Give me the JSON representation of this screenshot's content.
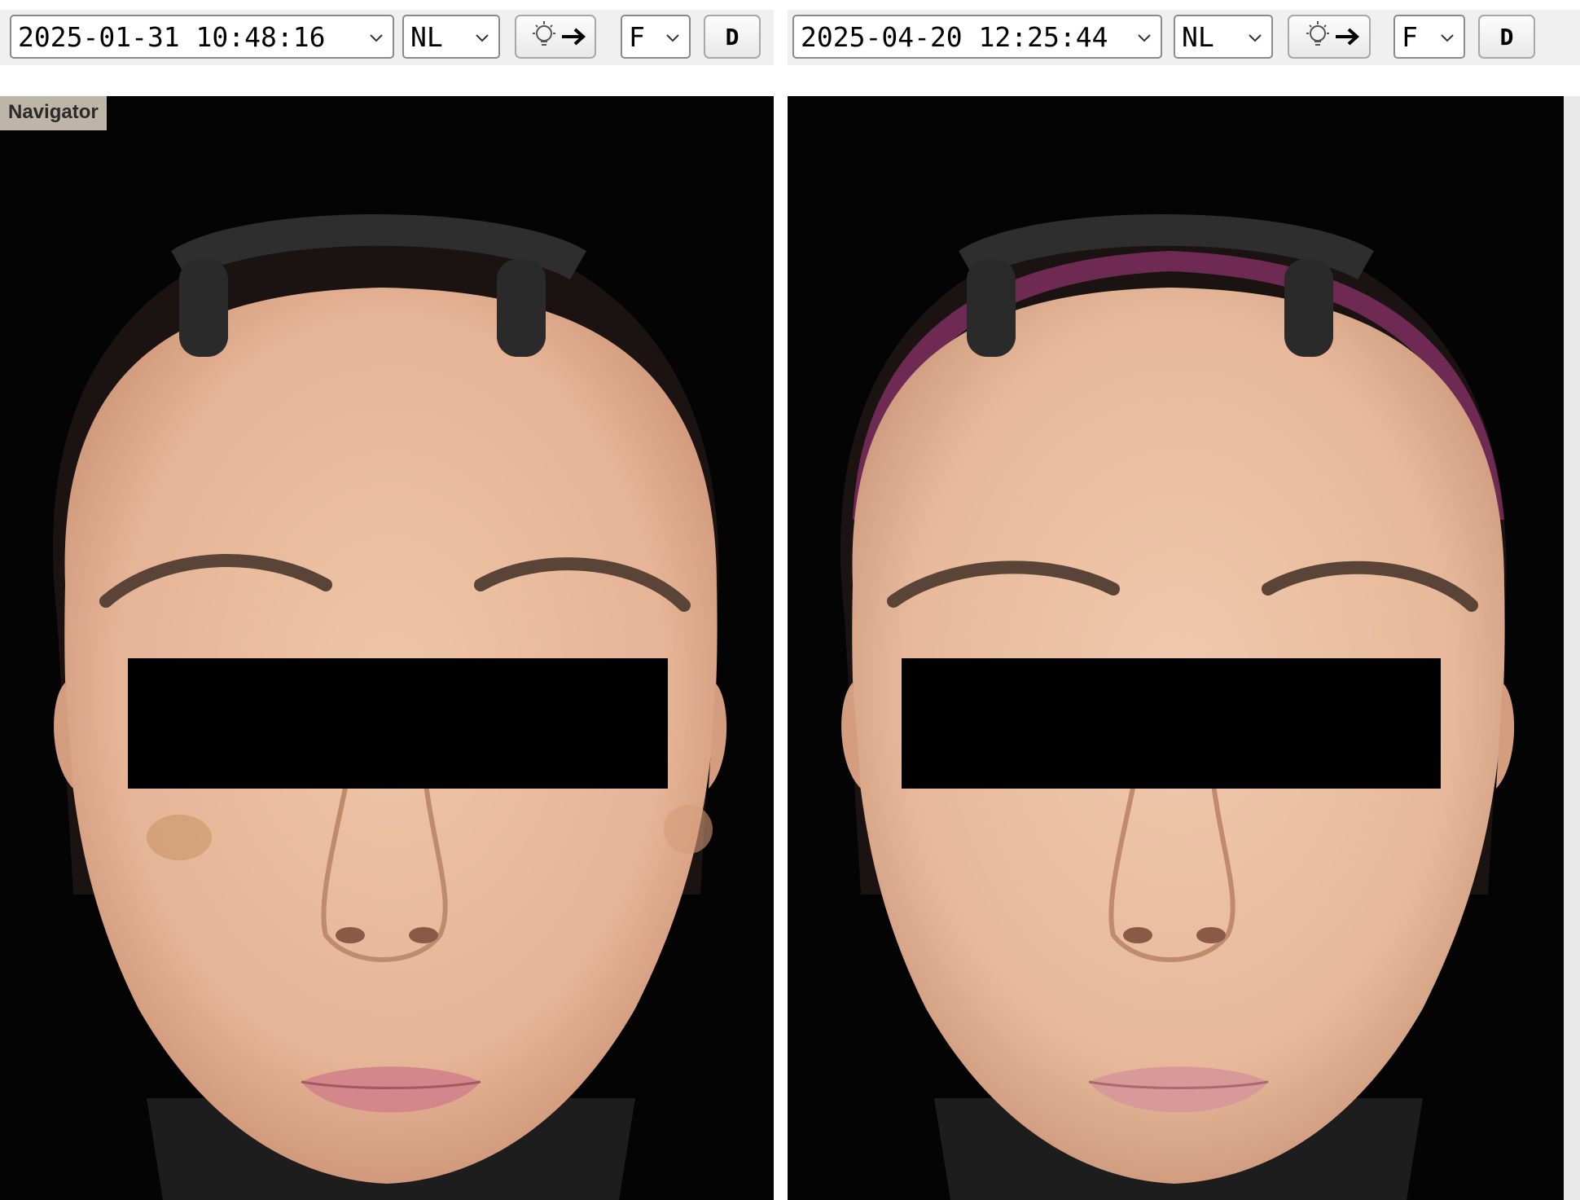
{
  "left_panel": {
    "datetime": "2025-01-31 10:48:16",
    "light_mode": "NL",
    "view": "F",
    "d_button": "D",
    "light_button_icon": "bulb-arrow-icon"
  },
  "right_panel": {
    "datetime": "2025-04-20 12:25:44",
    "light_mode": "NL",
    "view": "F",
    "d_button": "D",
    "light_button_icon": "bulb-arrow-icon"
  },
  "navigator": {
    "label": "Navigator"
  },
  "colors": {
    "photo_background": "#040404",
    "skin": "#e7b99a",
    "privacy_bar": "#000000",
    "headband_right": "#6e2a52"
  }
}
